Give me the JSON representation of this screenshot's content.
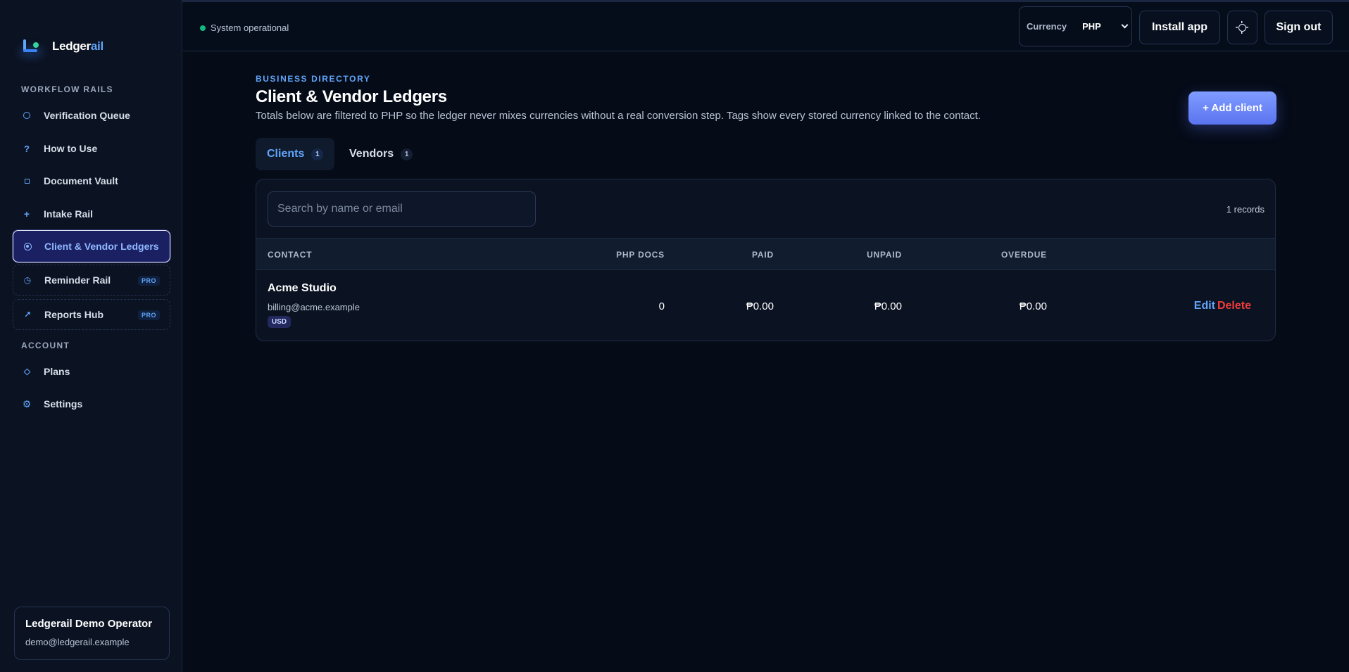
{
  "app": {
    "brand_main": "Ledger",
    "brand_highlight": "ail"
  },
  "sidebar": {
    "section_workflow": "WORKFLOW RAILS",
    "section_account": "ACCOUNT",
    "items": [
      {
        "label": "Verification Queue",
        "icon": "circle-icon"
      },
      {
        "label": "How to Use",
        "icon": "question-icon"
      },
      {
        "label": "Document Vault",
        "icon": "square-icon"
      },
      {
        "label": "Intake Rail",
        "icon": "plus-icon"
      },
      {
        "label": "Client & Vendor Ledgers",
        "icon": "target-icon",
        "active": true
      },
      {
        "label": "Reminder Rail",
        "icon": "clock-icon",
        "badge": "PRO"
      },
      {
        "label": "Reports Hub",
        "icon": "trend-arrow-icon",
        "badge": "PRO"
      }
    ],
    "account_items": [
      {
        "label": "Plans",
        "icon": "diamond-icon"
      },
      {
        "label": "Settings",
        "icon": "gear-icon"
      }
    ],
    "operator": {
      "name": "Ledgerail Demo Operator",
      "email": "demo@ledgerail.example"
    }
  },
  "topbar": {
    "status": "System operational",
    "currency_label": "Currency",
    "currency_value": "PHP",
    "install_label": "Install app",
    "theme_toggle_icon": "sun-icon",
    "signout_label": "Sign out"
  },
  "page": {
    "eyebrow": "BUSINESS DIRECTORY",
    "title": "Client & Vendor Ledgers",
    "description": "Totals below are filtered to PHP so the ledger never mixes currencies without a real conversion step. Tags show every stored currency linked to the contact.",
    "add_button": "+ Add client"
  },
  "tabs": [
    {
      "label": "Clients",
      "count": "1",
      "active": true
    },
    {
      "label": "Vendors",
      "count": "1",
      "active": false
    }
  ],
  "table": {
    "search_placeholder": "Search by name or email",
    "records": "1 records",
    "columns": [
      "CONTACT",
      "PHP DOCS",
      "PAID",
      "UNPAID",
      "OVERDUE"
    ],
    "rows": [
      {
        "name": "Acme Studio",
        "email": "billing@acme.example",
        "tag": "USD",
        "docs": "0",
        "paid": "₱0.00",
        "unpaid": "₱0.00",
        "overdue": "₱0.00",
        "edit": "Edit",
        "delete": "Delete"
      }
    ]
  },
  "colors": {
    "accent": "#60a5fa",
    "danger": "#ef3b3b",
    "status_ok": "#10b981",
    "background": "#050b17"
  }
}
